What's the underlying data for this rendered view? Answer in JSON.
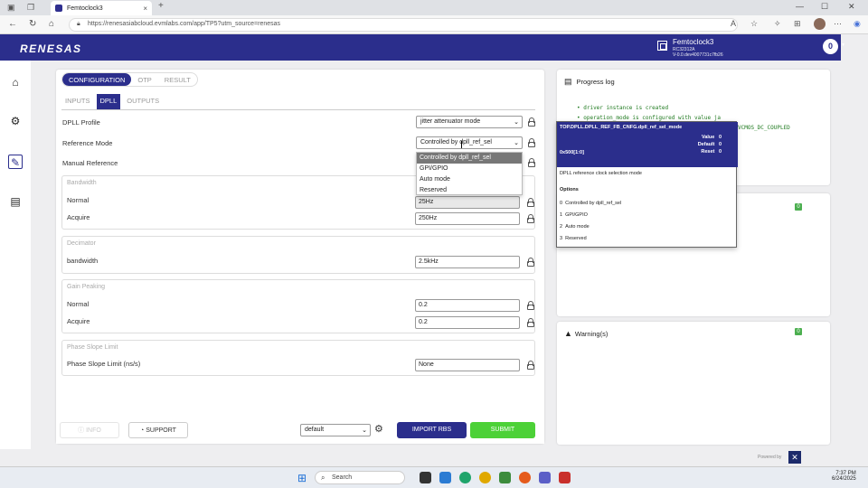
{
  "browser": {
    "tab_title": "Femtoclock3",
    "tab_close": "×",
    "new_tab": "+",
    "url": "https://renesasiabcloud.evmlabs.com/app/TP5?utm_source=renesas"
  },
  "header": {
    "logo": "RENESAS",
    "device_name": "Femtoclock3",
    "device_sub1": "RC32312A",
    "device_sub2": "V-0.0.dev4007731c7fb26",
    "notifications": "0"
  },
  "config": {
    "primary_tabs": [
      "CONFIGURATION",
      "OTP",
      "RESULT"
    ],
    "sub_tabs": [
      "INPUTS",
      "DPLL",
      "OUTPUTS"
    ],
    "dpll_profile_label": "DPLL Profile",
    "dpll_profile_value": "jitter attenuator mode",
    "reference_mode_label": "Reference Mode",
    "reference_mode_value": "Controlled by dpll_ref_sel",
    "manual_reference_label": "Manual Reference",
    "dropdown_options": [
      "Controlled by dpll_ref_sel",
      "GPI/GPIO",
      "Auto mode",
      "Reserved"
    ],
    "bandwidth_group": "Bandwidth",
    "bw_normal_label": "Normal",
    "bw_normal_value": "25Hz",
    "bw_acquire_label": "Acquire",
    "bw_acquire_value": "250Hz",
    "decimator_group": "Decimator",
    "dec_bandwidth_label": "bandwidth",
    "dec_bandwidth_value": "2.5kHz",
    "gain_group": "Gain Peaking",
    "gp_normal_label": "Normal",
    "gp_normal_value": "0.2",
    "gp_acquire_label": "Acquire",
    "gp_acquire_value": "0.2",
    "psl_group": "Phase Slope Limit",
    "psl_label": "Phase Slope Limit (ns/s)",
    "psl_value": "None"
  },
  "footer": {
    "info": "INFO",
    "support": "SUPPORT",
    "preset": "default",
    "import": "IMPORT RBS",
    "submit": "SUBMIT"
  },
  "progress": {
    "title": "Progress log",
    "lines": [
      "driver instance is created",
      "operation_mode is configured with value ja"
    ],
    "trail": "VCMOS_DC_COUPLED",
    "badge2": "0"
  },
  "warnings": {
    "title": "Warning(s)",
    "badge": "0"
  },
  "tooltip": {
    "register": "TOP.DPLL.DPLL_REF_FB_CNFG.dpll_ref_sel_mode",
    "value_label": "Value",
    "value": "0",
    "default_label": "Default",
    "default": "0",
    "reset_label": "Reset",
    "reset": "0",
    "address": "0x500[1:0]",
    "description": "DPLL reference clock selection mode",
    "options_title": "Options",
    "options": [
      {
        "num": "0",
        "text": "Controlled by dpll_ref_sel"
      },
      {
        "num": "1",
        "text": "GPI/GPIO"
      },
      {
        "num": "2",
        "text": "Auto mode"
      },
      {
        "num": "3",
        "text": "Reserved"
      }
    ]
  },
  "powered_by": "Powered by",
  "taskbar": {
    "search": "Search",
    "time": "7:37 PM",
    "date": "6/24/2025"
  }
}
